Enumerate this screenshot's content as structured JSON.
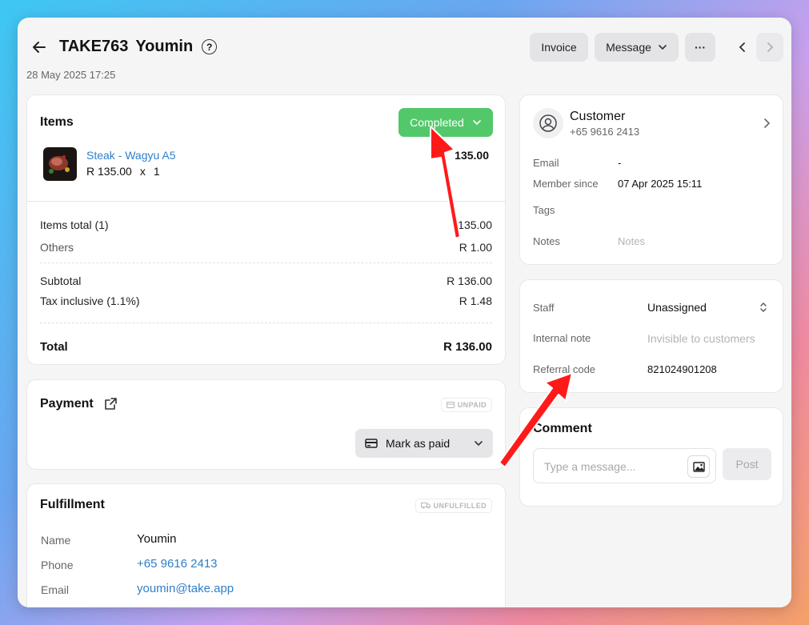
{
  "header": {
    "order_id": "TAKE763",
    "customer_name": "Youmin",
    "help_glyph": "?",
    "date": "28 May 2025 17:25",
    "invoice_label": "Invoice",
    "message_label": "Message",
    "more_label": "···"
  },
  "items": {
    "title": "Items",
    "status": "Completed",
    "status_color": "#52c86a",
    "product_name": "Steak - Wagyu A5",
    "product_price": "R 135.00",
    "product_qty_sep": "x",
    "product_qty": "1",
    "product_total": "135.00",
    "items_total_label": "Items total (1)",
    "items_total_value": "135.00",
    "others_label": "Others",
    "others_value": "R 1.00",
    "subtotal_label": "Subtotal",
    "subtotal_value": "R 136.00",
    "tax_label": "Tax inclusive (1.1%)",
    "tax_value": "R 1.48",
    "total_label": "Total",
    "total_value": "R 136.00"
  },
  "payment": {
    "title": "Payment",
    "badge": "UNPAID",
    "mark_paid_label": "Mark as paid"
  },
  "fulfillment": {
    "title": "Fulfillment",
    "badge": "UNFULFILLED",
    "name_label": "Name",
    "name_value": "Youmin",
    "phone_label": "Phone",
    "phone_value": "+65 9616 2413",
    "email_label": "Email",
    "email_value": "youmin@take.app"
  },
  "customer": {
    "title": "Customer",
    "phone": "+65 9616 2413",
    "email_label": "Email",
    "email_value": "-",
    "member_label": "Member since",
    "member_value": "07 Apr 2025 15:11",
    "tags_label": "Tags",
    "notes_label": "Notes",
    "notes_placeholder": "Notes"
  },
  "staff": {
    "staff_label": "Staff",
    "staff_value": "Unassigned",
    "internal_label": "Internal note",
    "internal_placeholder": "Invisible to customers",
    "referral_label": "Referral code",
    "referral_value": "821024901208"
  },
  "comment": {
    "title": "Comment",
    "placeholder": "Type a message...",
    "post_label": "Post"
  },
  "colors": {
    "accent_link": "#2f7fc8",
    "annotation_arrow": "#ff1a1a"
  }
}
